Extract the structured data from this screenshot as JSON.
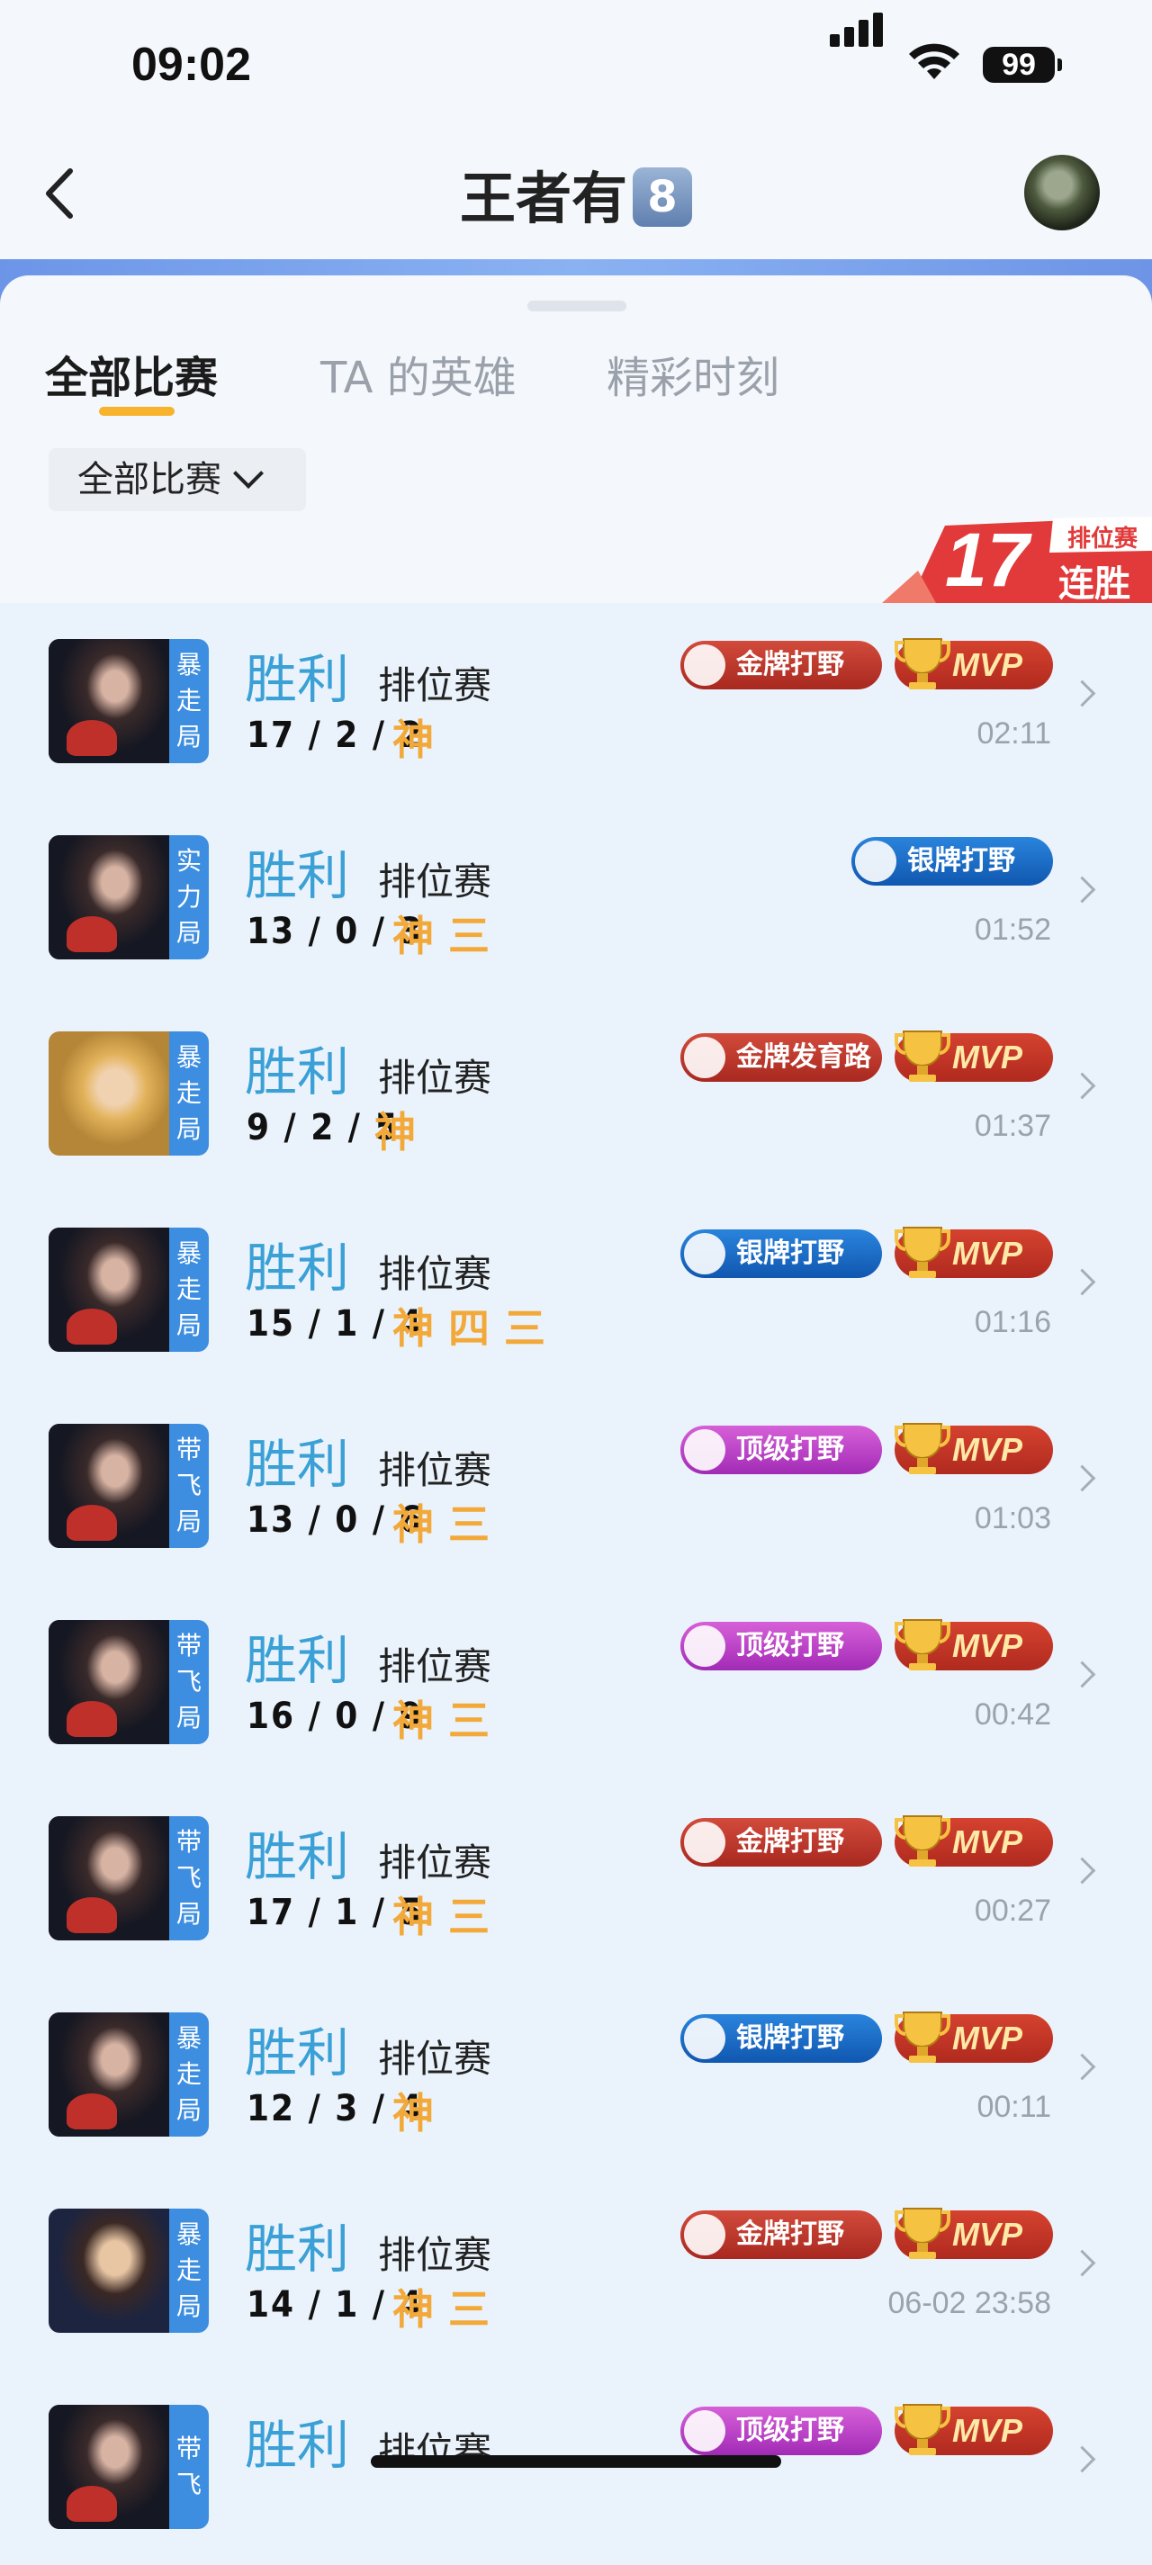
{
  "status_bar": {
    "time": "09:02",
    "battery": "99"
  },
  "header": {
    "title": "王者有",
    "badge": "8"
  },
  "tabs": [
    {
      "label": "全部比赛",
      "active": true
    },
    {
      "label": "TA 的英雄",
      "active": false
    },
    {
      "label": "精彩时刻",
      "active": false
    }
  ],
  "filter": {
    "label": "全部比赛"
  },
  "streak": {
    "count": "17",
    "label_top": "排位赛",
    "label_main": "连胜"
  },
  "matches": [
    {
      "result": "胜利",
      "mode": "排位赛",
      "kda": "17 / 2 / 2",
      "marks": "神",
      "tag": [
        "暴",
        "走",
        "局"
      ],
      "badge": "金牌打野",
      "badge_type": "gold",
      "mvp": "MVP",
      "time": "02:11",
      "hero": "dark"
    },
    {
      "result": "胜利",
      "mode": "排位赛",
      "kda": "13 / 0 / 3",
      "marks": "神 三",
      "tag": [
        "实",
        "力",
        "局"
      ],
      "badge": "银牌打野",
      "badge_type": "silver",
      "mvp": "",
      "time": "01:52",
      "hero": "dark"
    },
    {
      "result": "胜利",
      "mode": "排位赛",
      "kda": "9 / 2 / 5",
      "marks": "神",
      "tag": [
        "暴",
        "走",
        "局"
      ],
      "badge": "金牌发育路",
      "badge_type": "gold",
      "mvp": "MVP",
      "time": "01:37",
      "hero": "blonde"
    },
    {
      "result": "胜利",
      "mode": "排位赛",
      "kda": "15 / 1 / 4",
      "marks": "神 四 三",
      "tag": [
        "暴",
        "走",
        "局"
      ],
      "badge": "银牌打野",
      "badge_type": "silver",
      "mvp": "MVP",
      "time": "01:16",
      "hero": "dark"
    },
    {
      "result": "胜利",
      "mode": "排位赛",
      "kda": "13 / 0 / 6",
      "marks": "神 三",
      "tag": [
        "带",
        "飞",
        "局"
      ],
      "badge": "顶级打野",
      "badge_type": "top",
      "mvp": "MVP",
      "time": "01:03",
      "hero": "dark"
    },
    {
      "result": "胜利",
      "mode": "排位赛",
      "kda": "16 / 0 / 9",
      "marks": "神 三",
      "tag": [
        "带",
        "飞",
        "局"
      ],
      "badge": "顶级打野",
      "badge_type": "top",
      "mvp": "MVP",
      "time": "00:42",
      "hero": "dark"
    },
    {
      "result": "胜利",
      "mode": "排位赛",
      "kda": "17 / 1 / 5",
      "marks": "神 三",
      "tag": [
        "带",
        "飞",
        "局"
      ],
      "badge": "金牌打野",
      "badge_type": "gold",
      "mvp": "MVP",
      "time": "00:27",
      "hero": "dark"
    },
    {
      "result": "胜利",
      "mode": "排位赛",
      "kda": "12 / 3 / 4",
      "marks": "神",
      "tag": [
        "暴",
        "走",
        "局"
      ],
      "badge": "银牌打野",
      "badge_type": "silver",
      "mvp": "MVP",
      "time": "00:11",
      "hero": "dark"
    },
    {
      "result": "胜利",
      "mode": "排位赛",
      "kda": "14 / 1 / 4",
      "marks": "神 三",
      "tag": [
        "暴",
        "走",
        "局"
      ],
      "badge": "金牌打野",
      "badge_type": "gold",
      "mvp": "MVP",
      "time": "06-02 23:58",
      "hero": "boy"
    },
    {
      "result": "胜利",
      "mode": "排位赛",
      "kda": "",
      "marks": "",
      "tag": [
        "带",
        "飞",
        ""
      ],
      "badge": "顶级打野",
      "badge_type": "top",
      "mvp": "MVP",
      "time": "",
      "hero": "dark"
    }
  ]
}
